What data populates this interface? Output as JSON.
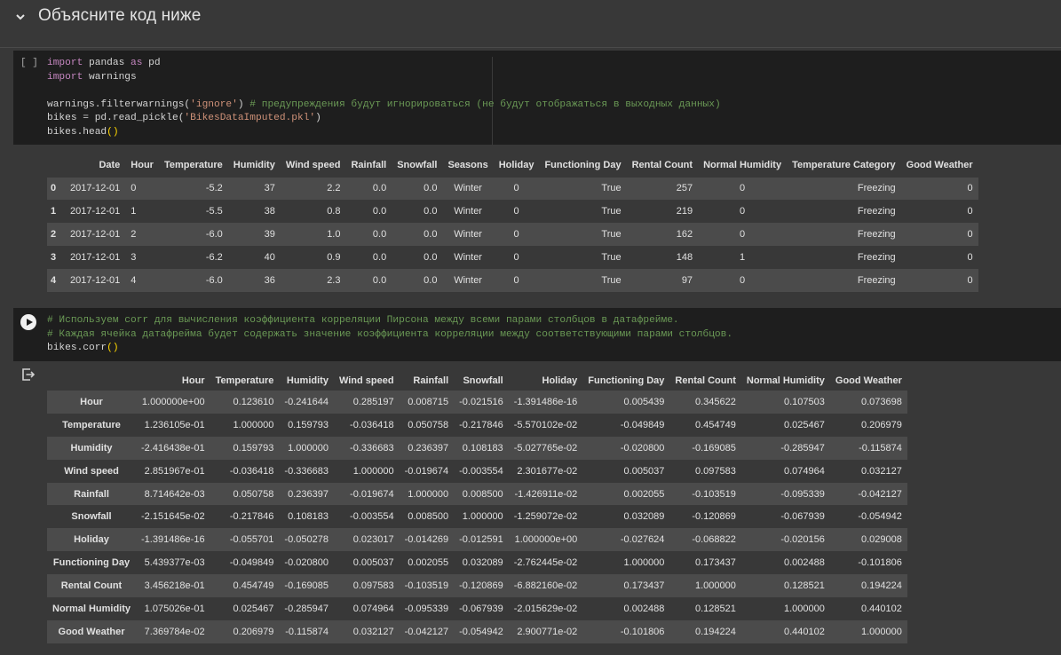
{
  "section": {
    "title": "Объясните код ниже",
    "chevron_icon": "chevron-down-icon"
  },
  "cell1": {
    "exec_label": "[ ]",
    "line1_import": "import",
    "line1_mod": " pandas ",
    "line1_as": "as",
    "line1_alias": " pd",
    "line2_import": "import",
    "line2_mod": " warnings",
    "line4_pre": "warnings.filterwarnings(",
    "line4_str": "'ignore'",
    "line4_post": ") ",
    "line4_comment": "# предупреждения будут игнорироваться (не будут отображаться в выходных данных)",
    "line5_pre": "bikes = pd.read_pickle(",
    "line5_str": "'BikesDataImputed.pkl'",
    "line5_post": ")",
    "line6_pre": "bikes.head",
    "line6_paren": "()"
  },
  "table1": {
    "columns": [
      "Date",
      "Hour",
      "Temperature",
      "Humidity",
      "Wind speed",
      "Rainfall",
      "Snowfall",
      "Seasons",
      "Holiday",
      "Functioning Day",
      "Rental Count",
      "Normal Humidity",
      "Temperature Category",
      "Good Weather"
    ],
    "rows": [
      {
        "index": "0",
        "cells": [
          "2017-12-01",
          "0",
          "-5.2",
          "37",
          "2.2",
          "0.0",
          "0.0",
          "Winter",
          "0",
          "True",
          "257",
          "0",
          "Freezing",
          "0"
        ]
      },
      {
        "index": "1",
        "cells": [
          "2017-12-01",
          "1",
          "-5.5",
          "38",
          "0.8",
          "0.0",
          "0.0",
          "Winter",
          "0",
          "True",
          "219",
          "0",
          "Freezing",
          "0"
        ]
      },
      {
        "index": "2",
        "cells": [
          "2017-12-01",
          "2",
          "-6.0",
          "39",
          "1.0",
          "0.0",
          "0.0",
          "Winter",
          "0",
          "True",
          "162",
          "0",
          "Freezing",
          "0"
        ]
      },
      {
        "index": "3",
        "cells": [
          "2017-12-01",
          "3",
          "-6.2",
          "40",
          "0.9",
          "0.0",
          "0.0",
          "Winter",
          "0",
          "True",
          "148",
          "1",
          "Freezing",
          "0"
        ]
      },
      {
        "index": "4",
        "cells": [
          "2017-12-01",
          "4",
          "-6.0",
          "36",
          "2.3",
          "0.0",
          "0.0",
          "Winter",
          "0",
          "True",
          "97",
          "0",
          "Freezing",
          "0"
        ]
      }
    ]
  },
  "cell2": {
    "comment1": "# Используем corr для вычисления коэффициента корреляции Пирсона между всеми парами столбцов в датафрейме.",
    "comment2": "# Каждая ячейка датафрейма будет содержать значение коэффициента корреляции между соответствующими парами столбцов.",
    "line3_pre": "bikes.corr",
    "line3_paren": "()"
  },
  "table2": {
    "columns": [
      "Hour",
      "Temperature",
      "Humidity",
      "Wind speed",
      "Rainfall",
      "Snowfall",
      "Holiday",
      "Functioning Day",
      "Rental Count",
      "Normal Humidity",
      "Good Weather"
    ],
    "rows": [
      {
        "index": "Hour",
        "cells": [
          "1.000000e+00",
          "0.123610",
          "-0.241644",
          "0.285197",
          "0.008715",
          "-0.021516",
          "-1.391486e-16",
          "0.005439",
          "0.345622",
          "0.107503",
          "0.073698"
        ]
      },
      {
        "index": "Temperature",
        "cells": [
          "1.236105e-01",
          "1.000000",
          "0.159793",
          "-0.036418",
          "0.050758",
          "-0.217846",
          "-5.570102e-02",
          "-0.049849",
          "0.454749",
          "0.025467",
          "0.206979"
        ]
      },
      {
        "index": "Humidity",
        "cells": [
          "-2.416438e-01",
          "0.159793",
          "1.000000",
          "-0.336683",
          "0.236397",
          "0.108183",
          "-5.027765e-02",
          "-0.020800",
          "-0.169085",
          "-0.285947",
          "-0.115874"
        ]
      },
      {
        "index": "Wind speed",
        "cells": [
          "2.851967e-01",
          "-0.036418",
          "-0.336683",
          "1.000000",
          "-0.019674",
          "-0.003554",
          "2.301677e-02",
          "0.005037",
          "0.097583",
          "0.074964",
          "0.032127"
        ]
      },
      {
        "index": "Rainfall",
        "cells": [
          "8.714642e-03",
          "0.050758",
          "0.236397",
          "-0.019674",
          "1.000000",
          "0.008500",
          "-1.426911e-02",
          "0.002055",
          "-0.103519",
          "-0.095339",
          "-0.042127"
        ]
      },
      {
        "index": "Snowfall",
        "cells": [
          "-2.151645e-02",
          "-0.217846",
          "0.108183",
          "-0.003554",
          "0.008500",
          "1.000000",
          "-1.259072e-02",
          "0.032089",
          "-0.120869",
          "-0.067939",
          "-0.054942"
        ]
      },
      {
        "index": "Holiday",
        "cells": [
          "-1.391486e-16",
          "-0.055701",
          "-0.050278",
          "0.023017",
          "-0.014269",
          "-0.012591",
          "1.000000e+00",
          "-0.027624",
          "-0.068822",
          "-0.020156",
          "0.029008"
        ]
      },
      {
        "index": "Functioning Day",
        "cells": [
          "5.439377e-03",
          "-0.049849",
          "-0.020800",
          "0.005037",
          "0.002055",
          "0.032089",
          "-2.762445e-02",
          "1.000000",
          "0.173437",
          "0.002488",
          "-0.101806"
        ]
      },
      {
        "index": "Rental Count",
        "cells": [
          "3.456218e-01",
          "0.454749",
          "-0.169085",
          "0.097583",
          "-0.103519",
          "-0.120869",
          "-6.882160e-02",
          "0.173437",
          "1.000000",
          "0.128521",
          "0.194224"
        ]
      },
      {
        "index": "Normal Humidity",
        "cells": [
          "1.075026e-01",
          "0.025467",
          "-0.285947",
          "0.074964",
          "-0.095339",
          "-0.067939",
          "-2.015629e-02",
          "0.002488",
          "0.128521",
          "1.000000",
          "0.440102"
        ]
      },
      {
        "index": "Good Weather",
        "cells": [
          "7.369784e-02",
          "0.206979",
          "-0.115874",
          "0.032127",
          "-0.042127",
          "-0.054942",
          "2.900771e-02",
          "-0.101806",
          "0.194224",
          "0.440102",
          "1.000000"
        ]
      }
    ]
  }
}
